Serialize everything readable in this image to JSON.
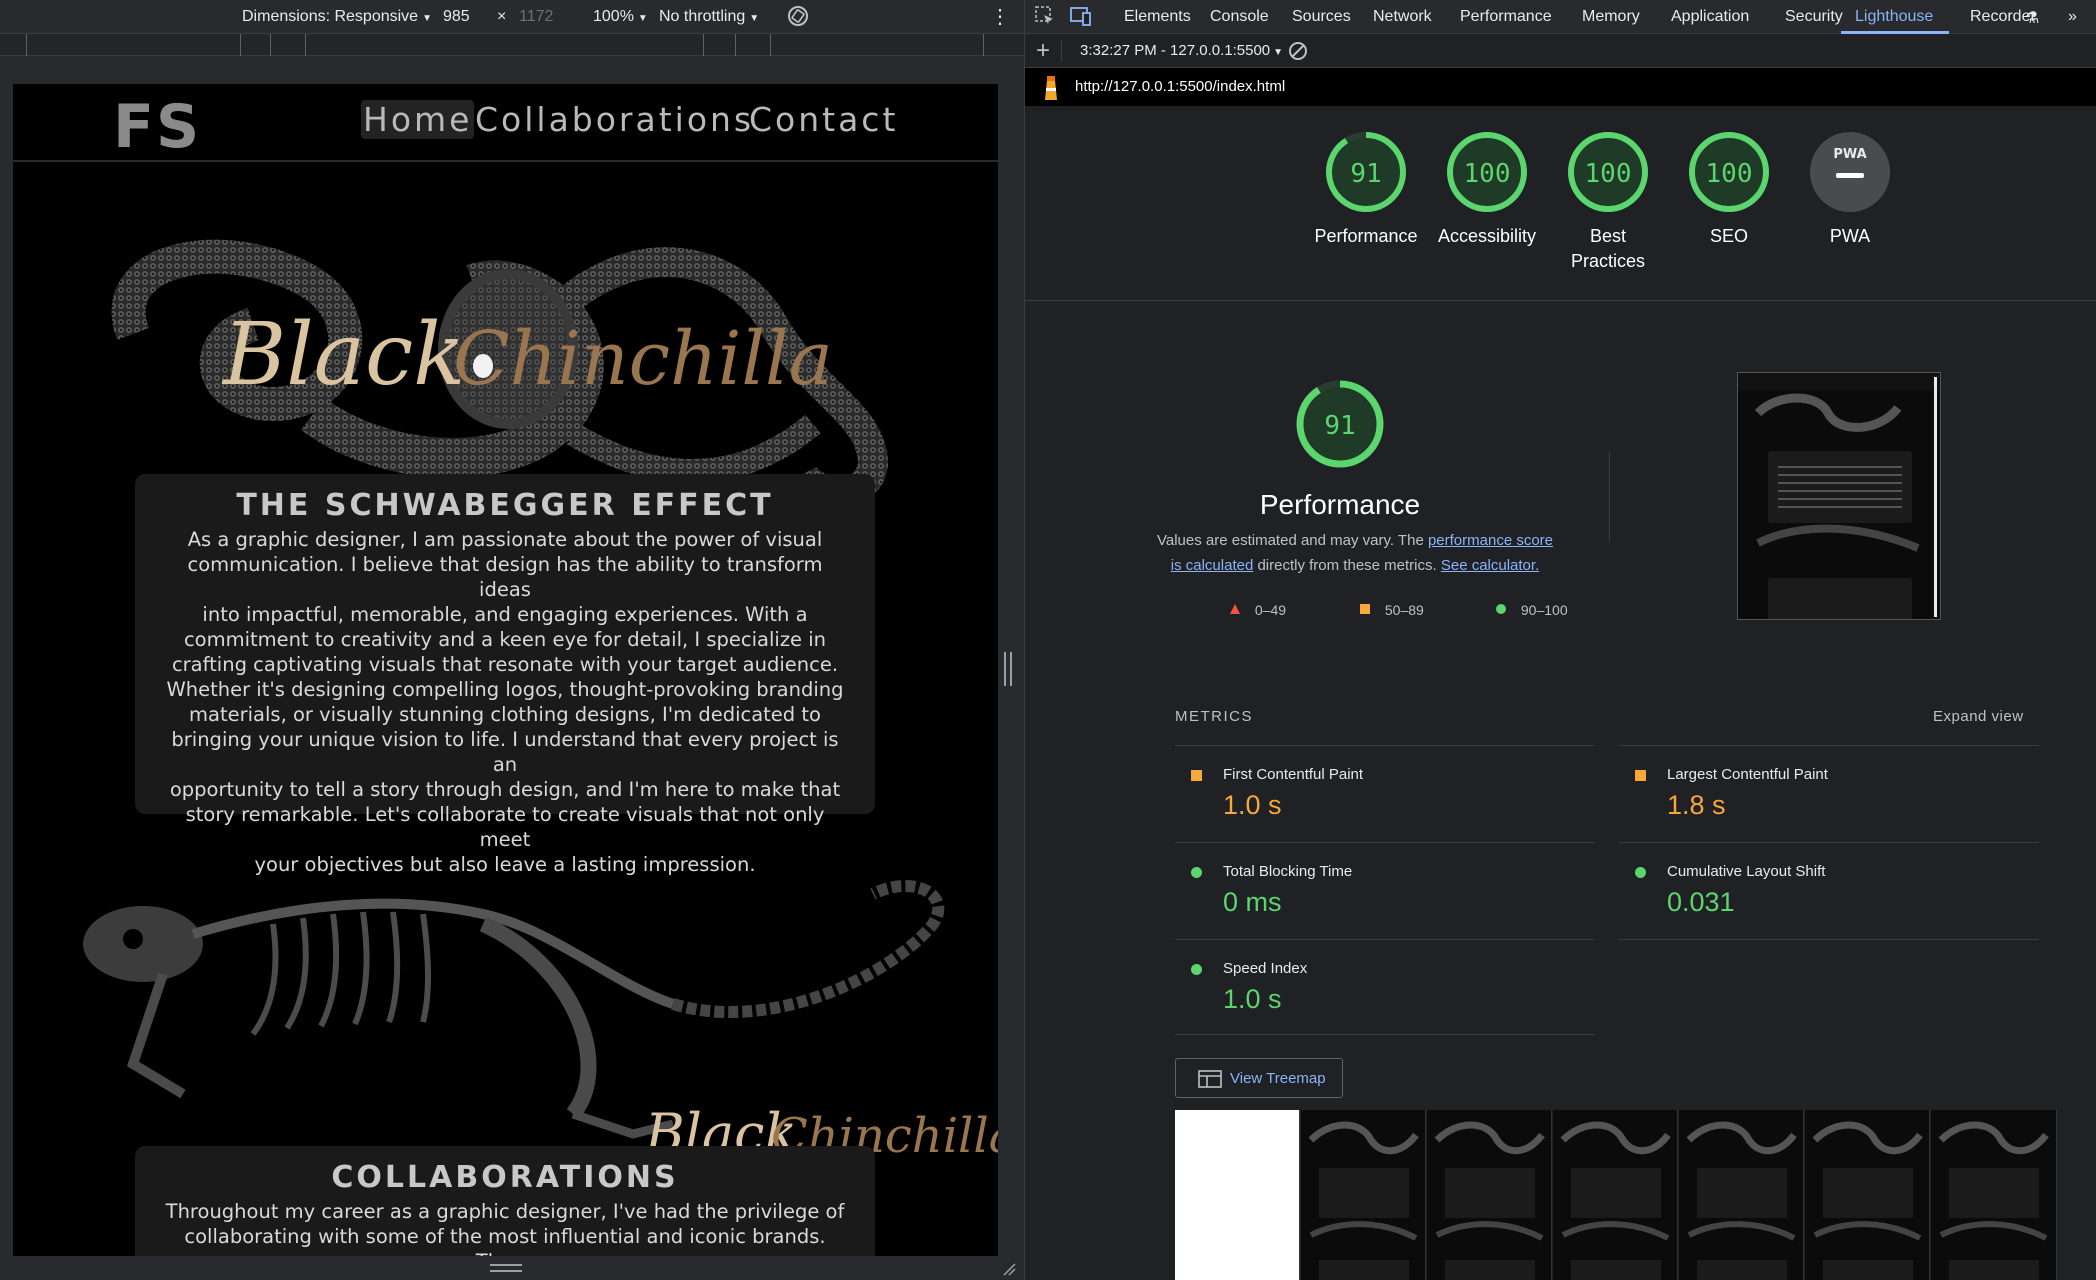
{
  "device_toolbar": {
    "dimensions_label": "Dimensions: Responsive",
    "width": "985",
    "times": "×",
    "height": "1172",
    "zoom": "100%",
    "throttling": "No throttling"
  },
  "site": {
    "logo": "FS",
    "nav": [
      "Home",
      "Collaborations",
      "Contact"
    ],
    "hero_script": [
      "Black",
      "Chinchilla"
    ],
    "section1": {
      "title": "THE SCHWABEGGER EFFECT",
      "lines": [
        "As a graphic designer, I am passionate about the power of visual",
        "communication. I believe that design has the ability to transform ideas",
        "into impactful, memorable, and engaging experiences. With a",
        "commitment to creativity and a keen eye for detail, I specialize in",
        "crafting captivating visuals that resonate with your target audience.",
        "Whether it's designing compelling logos, thought-provoking branding",
        "materials, or visually stunning clothing designs, I'm dedicated to",
        "bringing your unique vision to life. I understand that every project is an",
        "opportunity to tell a story through design, and I'm here to make that",
        "story remarkable. Let's collaborate to create visuals that not only meet",
        "your objectives but also leave a lasting impression."
      ]
    },
    "section2": {
      "title": "COLLABORATIONS",
      "lines": [
        "Throughout my career as a graphic designer, I've had the privilege of",
        "collaborating with some of the most influential and iconic brands. These"
      ]
    }
  },
  "devtools": {
    "tabs": [
      "Elements",
      "Console",
      "Sources",
      "Network",
      "Performance",
      "Memory",
      "Application",
      "Security",
      "Lighthouse",
      "Recorder"
    ],
    "active_tab": "Lighthouse",
    "report_selector": "3:32:27 PM - 127.0.0.1:5500",
    "url": "http://127.0.0.1:5500/index.html",
    "gauges": [
      {
        "score": "91",
        "label": "Performance",
        "value": 91
      },
      {
        "score": "100",
        "label": "Accessibility",
        "value": 100
      },
      {
        "score": "100",
        "label": "Best Practices",
        "value": 100
      },
      {
        "score": "100",
        "label": "SEO",
        "value": 100
      },
      {
        "score": "PWA",
        "label": "PWA",
        "value": 0
      }
    ],
    "performance": {
      "score": "91",
      "value": 91,
      "title": "Performance",
      "desc_prefix": "Values are estimated and may vary. The ",
      "desc_link1": "performance score is calculated",
      "desc_mid": " directly from these metrics. ",
      "desc_link2": "See calculator.",
      "legend": [
        "0–49",
        "50–89",
        "90–100"
      ]
    },
    "metrics_heading": "METRICS",
    "expand_view": "Expand view",
    "metrics": [
      {
        "name": "First Contentful Paint",
        "value": "1.0 s",
        "rating": "average"
      },
      {
        "name": "Largest Contentful Paint",
        "value": "1.8 s",
        "rating": "average"
      },
      {
        "name": "Total Blocking Time",
        "value": "0 ms",
        "rating": "pass"
      },
      {
        "name": "Cumulative Layout Shift",
        "value": "0.031",
        "rating": "pass"
      },
      {
        "name": "Speed Index",
        "value": "1.0 s",
        "rating": "pass"
      }
    ],
    "view_treemap": "View Treemap",
    "colors": {
      "pass": "#5bd56e",
      "average": "#f8a739",
      "fail": "#f4543f",
      "link": "#8ab4f8"
    }
  }
}
